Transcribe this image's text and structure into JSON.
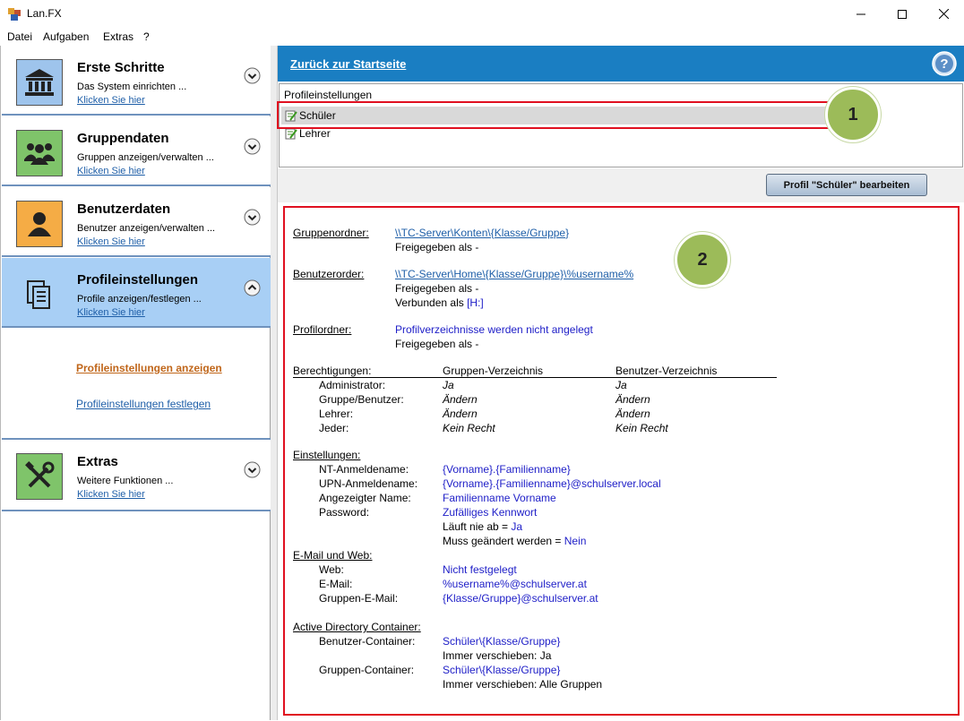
{
  "window": {
    "title": "Lan.FX"
  },
  "menu": [
    "Datei",
    "Aufgaben",
    "Extras",
    "?"
  ],
  "sidebar": {
    "blocks": [
      {
        "title": "Erste Schritte",
        "subtitle": "Das System einrichten ...",
        "link": "Klicken Sie hier",
        "icon": "bank-icon",
        "color": "#9ec4ec"
      },
      {
        "title": "Gruppendaten",
        "subtitle": "Gruppen anzeigen/verwalten ...",
        "link": "Klicken Sie hier",
        "icon": "group-icon",
        "color": "#7fc46a"
      },
      {
        "title": "Benutzerdaten",
        "subtitle": "Benutzer anzeigen/verwalten ...",
        "link": "Klicken Sie hier",
        "icon": "user-icon",
        "color": "#f5ac45"
      },
      {
        "title": "Profileinstellungen",
        "subtitle": "Profile anzeigen/festlegen ...",
        "link": "Klicken Sie hier",
        "icon": "profile-icon",
        "color": "#a8cff5"
      },
      {
        "title": "Extras",
        "subtitle": "Weitere Funktionen ...",
        "link": "Klicken Sie hier",
        "icon": "tools-icon",
        "color": "#7fc46a"
      }
    ],
    "sublinks": [
      "Profileinstellungen anzeigen",
      "Profileinstellungen festlegen"
    ]
  },
  "header": {
    "back_link": "Zurück zur Startseite"
  },
  "profiles": {
    "header": "Profileinstellungen",
    "items": [
      "Schüler",
      "Lehrer"
    ],
    "selected": "Schüler"
  },
  "callouts": [
    "1",
    "2"
  ],
  "toolbar": {
    "edit_button": "Profil \"Schüler\" bearbeiten"
  },
  "details": {
    "gruppenordner": {
      "label": "Gruppenordner:",
      "path": "\\\\TC-Server\\Konten\\{Klasse/Gruppe}",
      "shared": "Freigegeben als -"
    },
    "benutzerordner": {
      "label": "Benutzerorder:",
      "path": "\\\\TC-Server\\Home\\{Klasse/Gruppe}\\%username%",
      "shared": "Freigegeben als -",
      "connected_prefix": "Verbunden als ",
      "connected_drive": "[H:]"
    },
    "profilordner": {
      "label": "Profilordner:",
      "value": "Profilverzeichnisse werden nicht angelegt",
      "shared": "Freigegeben als -"
    },
    "berechtigungen": {
      "label": "Berechtigungen:",
      "col1": "Gruppen-Verzeichnis",
      "col2": "Benutzer-Verzeichnis",
      "rows": [
        {
          "name": "Administrator:",
          "v1": "Ja",
          "v2": "Ja"
        },
        {
          "name": "Gruppe/Benutzer:",
          "v1": "Ändern",
          "v2": "Ändern"
        },
        {
          "name": "Lehrer:",
          "v1": "Ändern",
          "v2": "Ändern"
        },
        {
          "name": "Jeder:",
          "v1": "Kein Recht",
          "v2": "Kein Recht"
        }
      ]
    },
    "einstellungen": {
      "label": "Einstellungen:",
      "nt_label": "NT-Anmeldename:",
      "nt_value": "{Vorname}.{Familienname}",
      "upn_label": "UPN-Anmeldename:",
      "upn_value": "{Vorname}.{Familienname}@schulserver.local",
      "display_label": "Angezeigter Name:",
      "display_value": "Familienname Vorname",
      "pw_label": "Password:",
      "pw_value": "Zufälliges Kennwort",
      "expire_prefix": "Läuft nie ab = ",
      "expire_value": "Ja",
      "change_prefix": "Muss geändert werden = ",
      "change_value": "Nein"
    },
    "email": {
      "label": "E-Mail und Web:",
      "web_label": "Web:",
      "web_value": "Nicht festgelegt",
      "mail_label": "E-Mail:",
      "mail_value": "%username%@schulserver.at",
      "group_mail_label": "Gruppen-E-Mail:",
      "group_mail_value": "{Klasse/Gruppe}@schulserver.at"
    },
    "ad": {
      "label": "Active Directory Container:",
      "user_label": "Benutzer-Container:",
      "user_value": "Schüler\\{Klasse/Gruppe}",
      "user_move": "Immer verschieben: Ja",
      "group_label": "Gruppen-Container:",
      "group_value": "Schüler\\{Klasse/Gruppe}",
      "group_move": "Immer verschieben: Alle Gruppen"
    }
  }
}
